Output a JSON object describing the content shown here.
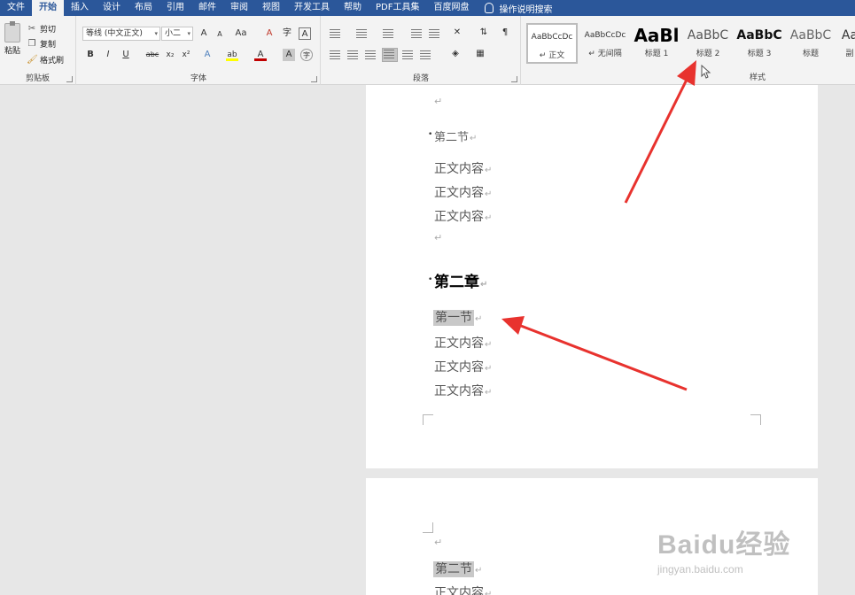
{
  "menubar": {
    "tabs": [
      "文件",
      "开始",
      "插入",
      "设计",
      "布局",
      "引用",
      "邮件",
      "审阅",
      "视图",
      "开发工具",
      "帮助",
      "PDF工具集",
      "百度网盘"
    ],
    "active_tab": "开始",
    "tell_me": "操作说明搜索"
  },
  "clipboard": {
    "paste": "粘贴",
    "cut": "剪切",
    "copy": "复制",
    "format_painter": "格式刷",
    "label": "剪贴板"
  },
  "font": {
    "name": "等线 (中文正文)",
    "size": "小二",
    "label": "字体",
    "buttons": {
      "bold": "B",
      "italic": "I",
      "underline": "U",
      "strike": "abc",
      "subscript": "x₂",
      "superscript": "x²",
      "grow": "A",
      "shrink": "A",
      "case": "Aa",
      "clear": "A",
      "char_border": "A",
      "text_effect": "A",
      "highlight": "ab",
      "font_color": "A",
      "char_shading": "A",
      "enclose": "字"
    },
    "font_color_hex": "#c00000",
    "highlight_hex": "#ffff00"
  },
  "paragraph": {
    "label": "段落"
  },
  "styles": {
    "label": "样式",
    "items": [
      {
        "preview": "AaBbCcDc",
        "name": "↵ 正文"
      },
      {
        "preview": "AaBbCcDc",
        "name": "↵ 无间隔"
      },
      {
        "preview": "AaBl",
        "name": "标题 1"
      },
      {
        "preview": "AaBbC",
        "name": "标题 2"
      },
      {
        "preview": "AaBbC",
        "name": "标题 3"
      },
      {
        "preview": "AaBbC",
        "name": "标题"
      },
      {
        "preview": "Aa",
        "name": "副"
      }
    ]
  },
  "document": {
    "page1": {
      "empty1": "↵",
      "section2": "第二节",
      "body1": "正文内容",
      "body2": "正文内容",
      "body3": "正文内容",
      "empty2": "↵",
      "chapter2": "第二章",
      "section1": "第一节",
      "body4": "正文内容",
      "body5": "正文内容",
      "body6": "正文内容"
    },
    "page2": {
      "empty": "↵",
      "section2": "第二节",
      "body": "正文内容"
    },
    "para_mark": "↵"
  },
  "watermark": {
    "logo": "Baidu经验",
    "url": "jingyan.baidu.com"
  },
  "colors": {
    "titlebar": "#2b579a",
    "ribbon": "#f3f3f3",
    "canvas": "#e7e7e7",
    "arrow": "#e8322e",
    "highlight": "#c8c8c8"
  }
}
